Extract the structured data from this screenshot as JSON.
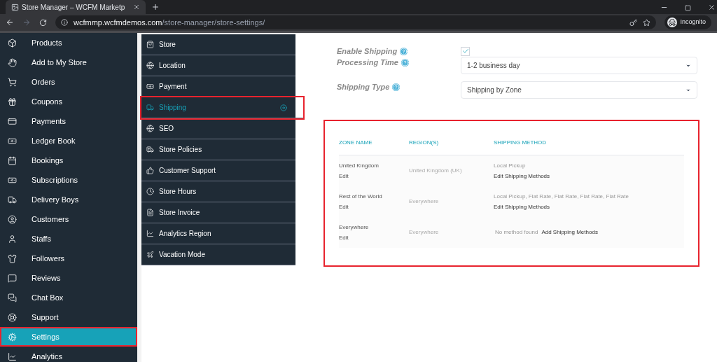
{
  "browser": {
    "tab_title": "Store Manager – WCFM Marketp",
    "url_host": "wcfmmp.wcfmdemos.com",
    "url_path": "/store-manager/store-settings/",
    "profile": "Incognito"
  },
  "sidebar": {
    "items": [
      {
        "label": "Products",
        "selected": false,
        "highlighted": false
      },
      {
        "label": "Add to My Store",
        "selected": false,
        "highlighted": false
      },
      {
        "label": "Orders",
        "selected": false,
        "highlighted": false
      },
      {
        "label": "Coupons",
        "selected": false,
        "highlighted": false
      },
      {
        "label": "Payments",
        "selected": false,
        "highlighted": false
      },
      {
        "label": "Ledger Book",
        "selected": false,
        "highlighted": false
      },
      {
        "label": "Bookings",
        "selected": false,
        "highlighted": false
      },
      {
        "label": "Subscriptions",
        "selected": false,
        "highlighted": false
      },
      {
        "label": "Delivery Boys",
        "selected": false,
        "highlighted": false
      },
      {
        "label": "Customers",
        "selected": false,
        "highlighted": false
      },
      {
        "label": "Staffs",
        "selected": false,
        "highlighted": false
      },
      {
        "label": "Followers",
        "selected": false,
        "highlighted": false
      },
      {
        "label": "Reviews",
        "selected": false,
        "highlighted": false
      },
      {
        "label": "Chat Box",
        "selected": false,
        "highlighted": false
      },
      {
        "label": "Support",
        "selected": false,
        "highlighted": false
      },
      {
        "label": "Settings",
        "selected": true,
        "highlighted": true
      },
      {
        "label": "Analytics",
        "selected": false,
        "highlighted": false
      }
    ]
  },
  "settings_menu": {
    "items": [
      {
        "label": "Store",
        "selected": false,
        "highlighted": false
      },
      {
        "label": "Location",
        "selected": false,
        "highlighted": false
      },
      {
        "label": "Payment",
        "selected": false,
        "highlighted": false
      },
      {
        "label": "Shipping",
        "selected": true,
        "highlighted": true
      },
      {
        "label": "SEO",
        "selected": false,
        "highlighted": false
      },
      {
        "label": "Store Policies",
        "selected": false,
        "highlighted": false
      },
      {
        "label": "Customer Support",
        "selected": false,
        "highlighted": false
      },
      {
        "label": "Store Hours",
        "selected": false,
        "highlighted": false
      },
      {
        "label": "Store Invoice",
        "selected": false,
        "highlighted": false
      },
      {
        "label": "Analytics Region",
        "selected": false,
        "highlighted": false
      },
      {
        "label": "Vacation Mode",
        "selected": false,
        "highlighted": false
      }
    ]
  },
  "form": {
    "enable_shipping": {
      "label": "Enable Shipping",
      "checked": true
    },
    "processing_time": {
      "label": "Processing Time",
      "value": "1-2 business day"
    },
    "shipping_type": {
      "label": "Shipping Type",
      "value": "Shipping by Zone"
    }
  },
  "zones_table": {
    "highlighted": true,
    "columns": [
      "ZONE NAME",
      "REGION(S)",
      "SHIPPING METHOD"
    ],
    "rows": [
      {
        "zone": "United Kingdom",
        "edit": "Edit",
        "region": "United Kingdom (UK)",
        "methods": "Local Pickup",
        "action": "Edit Shipping Methods",
        "kind": "methods"
      },
      {
        "zone": "Rest of the World",
        "edit": "Edit",
        "region": "Everywhere",
        "methods": "Local Pickup, Flat Rate, Flat Rate, Flat Rate, Flat Rate",
        "action": "Edit Shipping Methods",
        "kind": "methods"
      },
      {
        "zone": "Everywhere",
        "edit": "Edit",
        "region": "Everywhere",
        "methods": "No method found",
        "action": "Add Shipping Methods",
        "kind": "empty"
      }
    ]
  }
}
